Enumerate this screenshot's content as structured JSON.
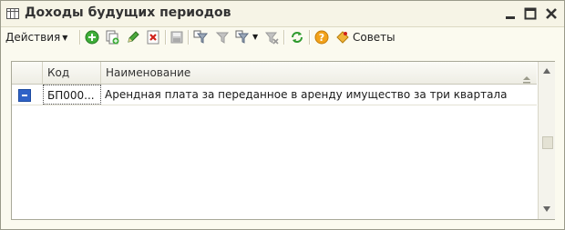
{
  "window": {
    "title": "Доходы будущих периодов",
    "controls": [
      "minimize",
      "maximize",
      "close"
    ]
  },
  "toolbar": {
    "actions_label": "Действия",
    "sovety_label": "Советы",
    "icons": [
      "add-icon",
      "copy-icon",
      "edit-icon",
      "delete-icon",
      "save-icon",
      "filter-icon",
      "filter-off-icon",
      "filter-menu-icon",
      "filter-clear-icon",
      "refresh-icon",
      "help-icon",
      "tips-icon"
    ]
  },
  "grid": {
    "columns": [
      "",
      "Код",
      "Наименование"
    ],
    "rows": [
      {
        "code": "БП000...",
        "name": "Арендная плата за переданное в аренду имущество за три квартала"
      }
    ]
  },
  "colors": {
    "accent": "#2f62c7",
    "window_bg": "#fbfaef",
    "titlebar_bg": "#f6f4e6"
  }
}
